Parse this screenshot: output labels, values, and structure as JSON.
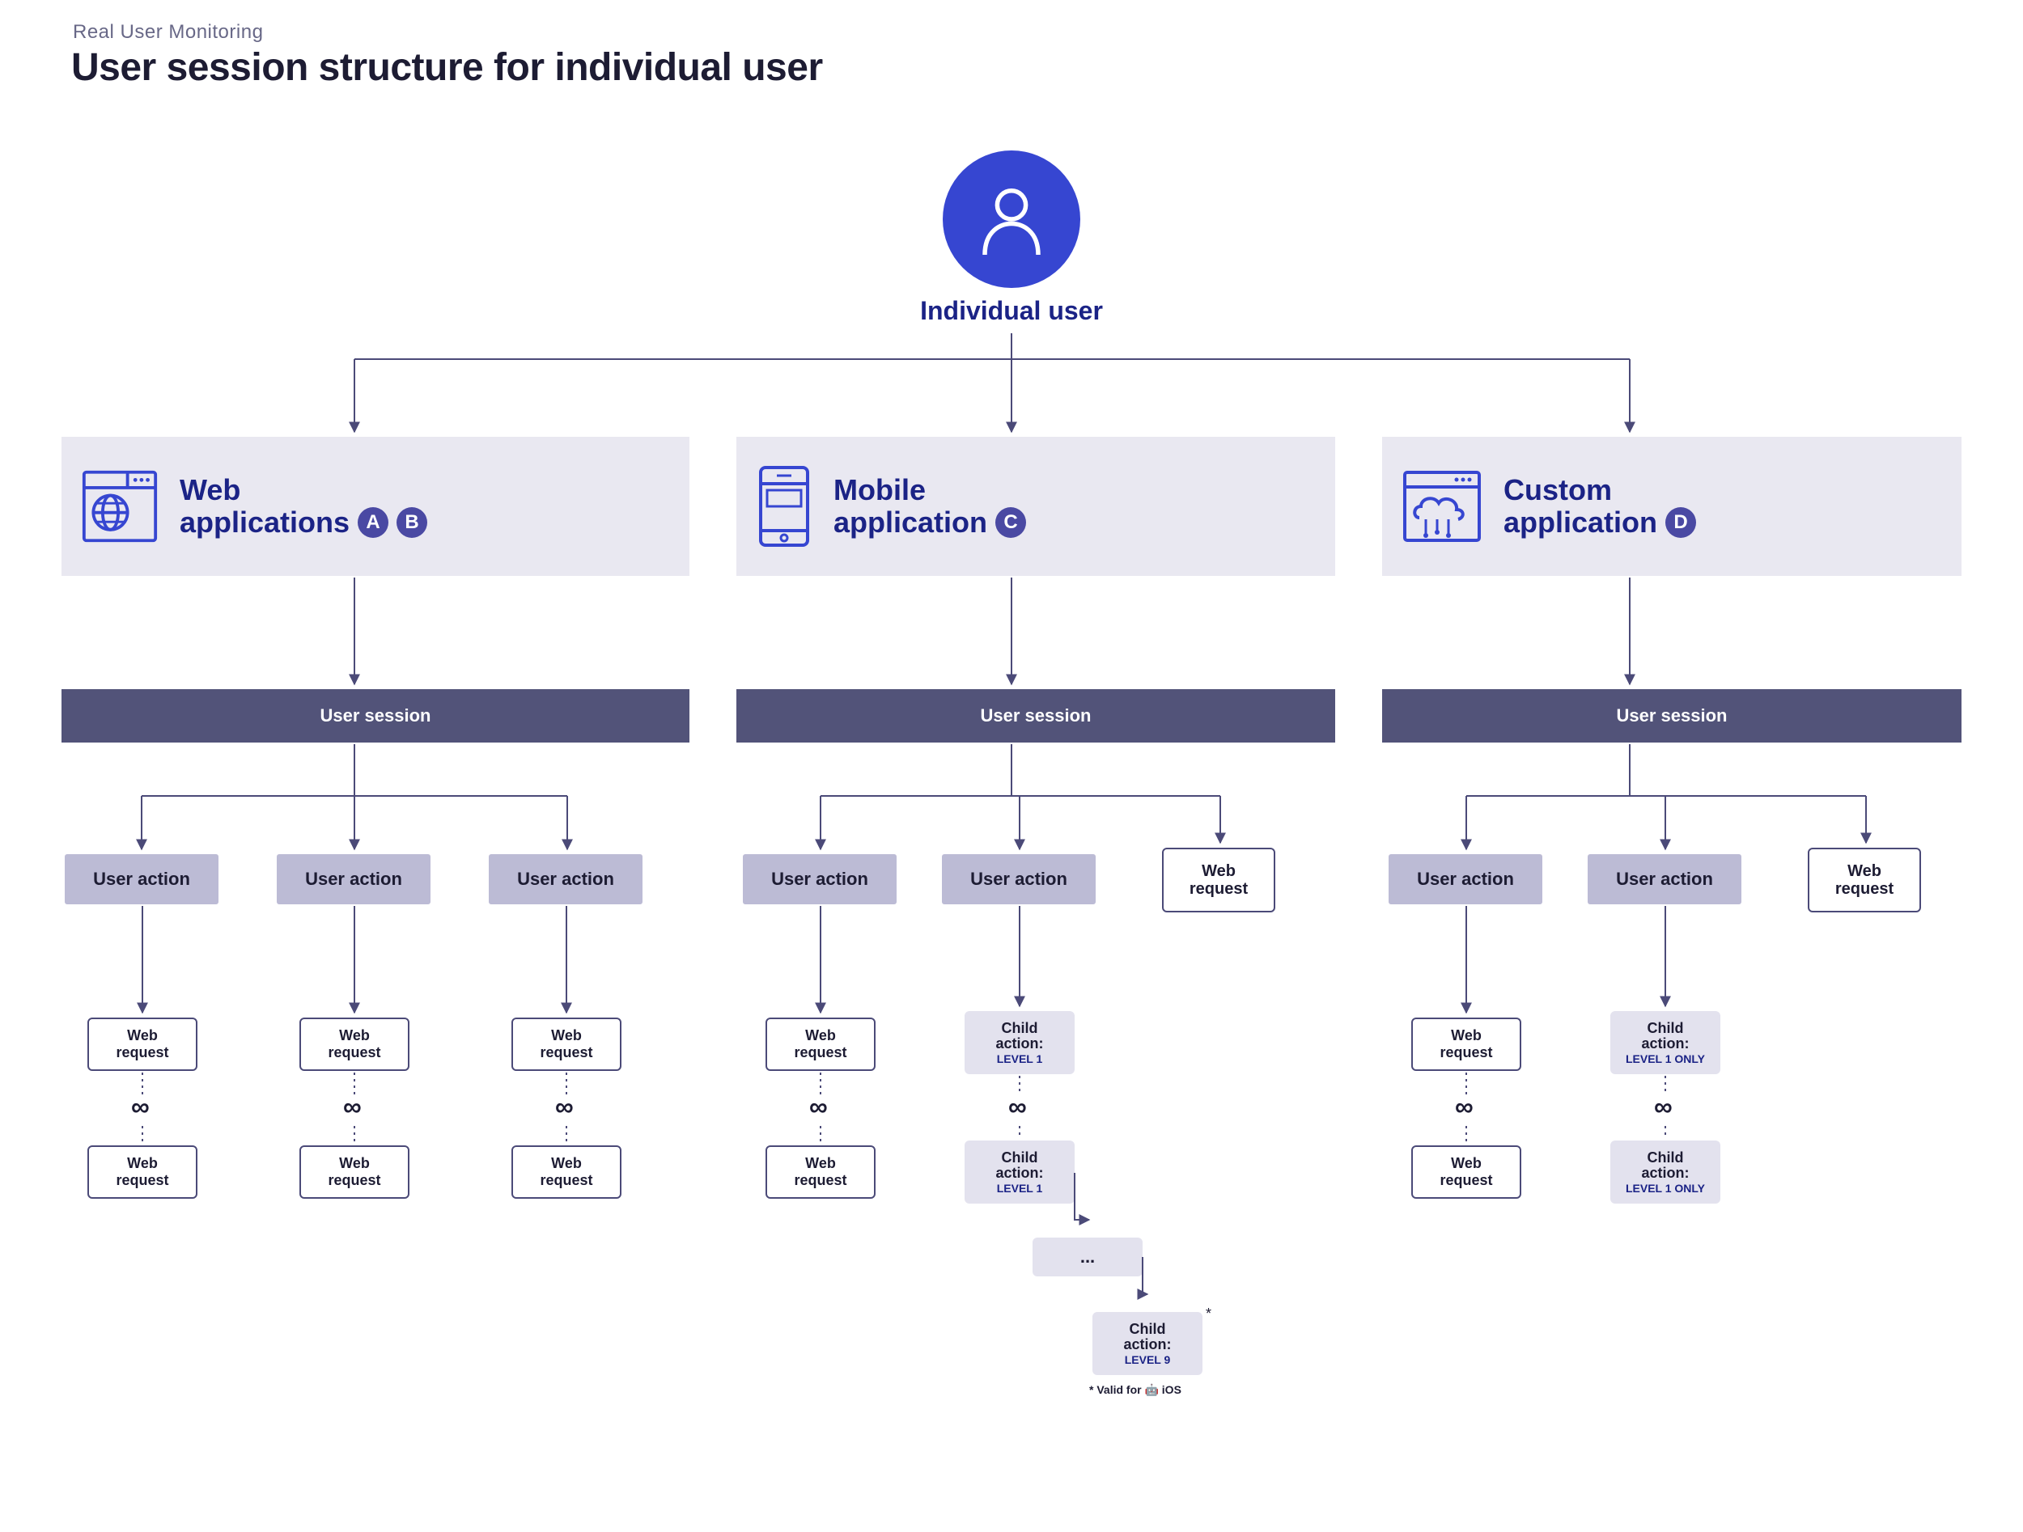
{
  "eyebrow": "Real User Monitoring",
  "title": "User session structure for individual user",
  "user_label": "Individual user",
  "apps": {
    "web": {
      "line1": "Web",
      "line2_prefix": "applications",
      "badges": [
        "A",
        "B"
      ]
    },
    "mobile": {
      "line1": "Mobile",
      "line2_prefix": "application",
      "badges": [
        "C"
      ]
    },
    "custom": {
      "line1": "Custom",
      "line2_prefix": "application",
      "badges": [
        "D"
      ]
    }
  },
  "session_label": "User session",
  "user_action_label": "User action",
  "web_request_label": "Web\nrequest",
  "infinity_glyph": "∞",
  "child_action_label": "Child\naction:",
  "levels": {
    "l1": "LEVEL 1",
    "l1_only": "LEVEL 1 ONLY",
    "l9": "LEVEL 9",
    "ellipsis": "..."
  },
  "valid_note": "* Valid for",
  "valid_platforms": "🤖 iOS"
}
